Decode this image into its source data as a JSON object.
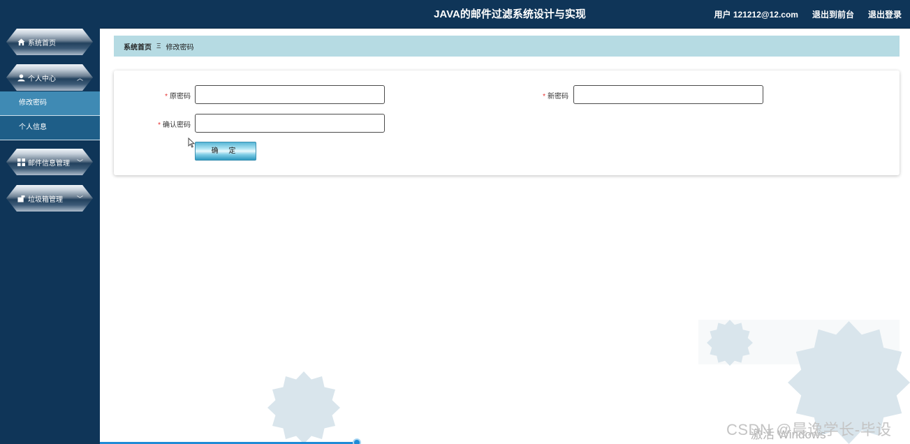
{
  "header": {
    "title": "JAVA的邮件过滤系统设计与实现",
    "user": "用户 121212@12.com",
    "back_to_front": "退出到前台",
    "logout": "退出登录"
  },
  "sidebar": {
    "items": [
      {
        "label": "系统首页",
        "icon": "home-icon"
      },
      {
        "label": "个人中心",
        "icon": "user-icon",
        "expanded": true,
        "children": [
          {
            "label": "修改密码",
            "active": true
          },
          {
            "label": "个人信息"
          }
        ]
      },
      {
        "label": "邮件信息管理",
        "icon": "grid-icon"
      },
      {
        "label": "垃圾箱管理",
        "icon": "trash-icon"
      }
    ]
  },
  "breadcrumb": {
    "home": "系统首页",
    "separator": "Ξ",
    "current": "修改密码"
  },
  "form": {
    "required_mark": "*",
    "old_password_label": "原密码",
    "new_password_label": "新密码",
    "confirm_password_label": "确认密码",
    "submit_label": "确 定"
  },
  "watermark": {
    "csdn": "CSDN @晨逸学长-毕设",
    "windows": "激活 Windows"
  },
  "colors": {
    "header_bg": "#0f3558",
    "sidebar_bg": "#0f3558",
    "submenu_active": "#3f8ab4",
    "breadcrumb_bg": "#b6dbe3",
    "required": "#e5302f"
  }
}
